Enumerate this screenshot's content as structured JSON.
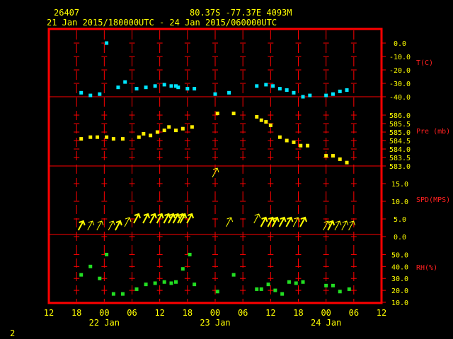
{
  "header": {
    "station": "26407",
    "location": "80.37S   -77.37E   4093M",
    "period": "21 Jan 2015/180000UTC - 24 Jan 2015/060000UTC"
  },
  "footer": {
    "page_number": "2"
  },
  "colors": {
    "frame": "#ff0000",
    "text": "#ffff00",
    "axis_label": "#ff2020",
    "temperature": "#00e5ff",
    "pressure": "#ffee00",
    "wind": "#ffff00",
    "humidity": "#22dd22"
  },
  "chart_data": {
    "type": "scatter",
    "x_unit": "hours since 21 Jan 2015 12UTC",
    "x_range": [
      0,
      72
    ],
    "x_ticks": [
      {
        "x": 0,
        "label": "12"
      },
      {
        "x": 6,
        "label": "18"
      },
      {
        "x": 12,
        "label": "00"
      },
      {
        "x": 18,
        "label": "06"
      },
      {
        "x": 24,
        "label": "12"
      },
      {
        "x": 30,
        "label": "18"
      },
      {
        "x": 36,
        "label": "00"
      },
      {
        "x": 42,
        "label": "06"
      },
      {
        "x": 48,
        "label": "12"
      },
      {
        "x": 54,
        "label": "18"
      },
      {
        "x": 60,
        "label": "00"
      },
      {
        "x": 66,
        "label": "06"
      },
      {
        "x": 72,
        "label": "12"
      }
    ],
    "day_labels": [
      {
        "x": 12,
        "label": "22 Jan"
      },
      {
        "x": 36,
        "label": "23 Jan"
      },
      {
        "x": 60,
        "label": "24 Jan"
      }
    ],
    "panels": [
      {
        "id": "temperature",
        "label": "T(C)",
        "y_range": [
          -40,
          0
        ],
        "ticks": [
          {
            "v": 0,
            "label": "0.0"
          },
          {
            "v": -10,
            "label": "-10.0"
          },
          {
            "v": -20,
            "label": "-20.0"
          },
          {
            "v": -30,
            "label": "-30.0"
          },
          {
            "v": -40,
            "label": "-40.0"
          }
        ],
        "x": [
          7,
          9,
          11,
          12.5,
          15,
          16.5,
          19,
          21,
          23,
          25,
          26.5,
          27.5,
          28,
          30,
          31.5,
          36,
          39,
          45,
          47,
          48.5,
          50,
          51.5,
          53,
          55,
          56.5,
          60,
          61.5,
          63,
          64.5
        ],
        "values": [
          -37,
          -39,
          -38,
          0,
          -33,
          -29,
          -34,
          -33,
          -32,
          -31,
          -32,
          -32,
          -33,
          -34,
          -34,
          -38,
          -37,
          -32,
          -31,
          -32,
          -34,
          -35,
          -37,
          -40,
          -39,
          -39,
          -38,
          -36,
          -35
        ]
      },
      {
        "id": "pressure",
        "label": "Pre (mb)",
        "y_range": [
          583,
          586.5
        ],
        "ticks": [
          {
            "v": 583,
            "label": "583.0"
          },
          {
            "v": 583.5,
            "label": "583.5"
          },
          {
            "v": 584,
            "label": "584.0"
          },
          {
            "v": 584.5,
            "label": "584.5"
          },
          {
            "v": 585,
            "label": "585.0"
          },
          {
            "v": 585.5,
            "label": "585.5"
          },
          {
            "v": 586,
            "label": "586.0"
          }
        ],
        "x": [
          7,
          9,
          10.5,
          12.5,
          14,
          16,
          19.5,
          20.5,
          22,
          23.5,
          25,
          26,
          27.5,
          29,
          31,
          36.5,
          40,
          45,
          46,
          47,
          48,
          50,
          51.5,
          53,
          54.5,
          56,
          60,
          61.5,
          63,
          64.5
        ],
        "values": [
          584.6,
          584.7,
          584.7,
          584.7,
          584.6,
          584.6,
          584.7,
          584.9,
          584.8,
          585.0,
          585.1,
          585.3,
          585.1,
          585.2,
          585.3,
          586.1,
          586.1,
          585.9,
          585.7,
          585.6,
          585.4,
          584.7,
          584.5,
          584.4,
          584.2,
          584.2,
          583.6,
          583.6,
          583.4,
          583.2
        ]
      },
      {
        "id": "wind",
        "label": "SPD(MPS)",
        "y_range": [
          0,
          20
        ],
        "ticks": [
          {
            "v": 0,
            "label": "0.0"
          },
          {
            "v": 5,
            "label": "5.0"
          },
          {
            "v": 10,
            "label": "10.0"
          },
          {
            "v": 15,
            "label": "15.0"
          }
        ],
        "x": [
          7,
          9,
          11,
          13.5,
          15,
          17,
          19,
          21,
          22.5,
          24,
          25.5,
          26.5,
          27.5,
          28.5,
          29,
          30.5,
          36,
          39,
          45,
          46.5,
          48,
          49,
          50.5,
          52,
          53.5,
          55,
          60,
          61,
          62.5,
          64,
          65.5
        ],
        "values": [
          3,
          3,
          3,
          3,
          3,
          4,
          5,
          5,
          5,
          5,
          5,
          5,
          5,
          5,
          5,
          5,
          18,
          4,
          5,
          4,
          4,
          4,
          4,
          4,
          4,
          4,
          3,
          3,
          3,
          3,
          3
        ],
        "strong_flags": [
          true,
          false,
          false,
          false,
          true,
          false,
          true,
          true,
          true,
          true,
          true,
          true,
          true,
          true,
          true,
          true,
          false,
          false,
          false,
          true,
          true,
          true,
          true,
          true,
          false,
          true,
          false,
          true,
          false,
          false,
          false
        ]
      },
      {
        "id": "humidity",
        "label": "RH(%)",
        "y_range": [
          10,
          55
        ],
        "ticks": [
          {
            "v": 10,
            "label": "10.0"
          },
          {
            "v": 20,
            "label": "20.0"
          },
          {
            "v": 30,
            "label": "30.0"
          },
          {
            "v": 40,
            "label": "40.0"
          },
          {
            "v": 50,
            "label": "50.0"
          }
        ],
        "x": [
          7,
          9,
          11,
          12.5,
          14,
          16,
          19,
          21,
          23,
          25,
          26.5,
          27.5,
          29,
          30.5,
          31.5,
          36.5,
          40,
          45,
          46,
          47.5,
          49,
          50.5,
          52,
          53.5,
          55,
          60,
          61.5,
          63,
          65
        ],
        "values": [
          33,
          40,
          30,
          50,
          17,
          17,
          21,
          25,
          26,
          27,
          26,
          27,
          38,
          50,
          25,
          19,
          33,
          21,
          21,
          25,
          20,
          17,
          27,
          26,
          27,
          24,
          24,
          19,
          21
        ]
      }
    ]
  }
}
